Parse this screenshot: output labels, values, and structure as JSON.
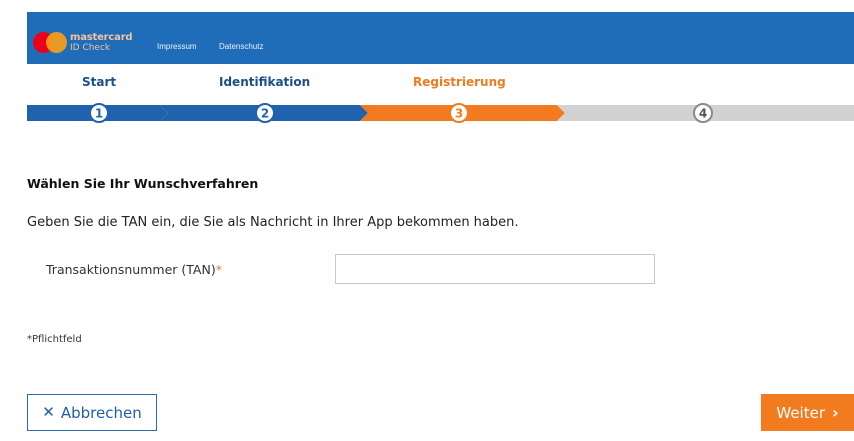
{
  "header": {
    "brand_line1": "mastercard",
    "brand_line2": "ID Check",
    "links": [
      "Impressum",
      "Datenschutz"
    ]
  },
  "stepper": {
    "steps": [
      {
        "number": "1",
        "label": "Start",
        "state": "done"
      },
      {
        "number": "2",
        "label": "Identifikation",
        "state": "done"
      },
      {
        "number": "3",
        "label": "Registrierung",
        "state": "active"
      },
      {
        "number": "4",
        "label": "",
        "state": "pending"
      }
    ],
    "colors": {
      "done": "#1f62ad",
      "active": "#f27b1f",
      "pending": "#d2d2d2"
    }
  },
  "form": {
    "heading": "Wählen Sie Ihr Wunschverfahren",
    "instruction": "Geben Sie die TAN ein, die Sie als Nachricht in Ihrer App bekommen haben.",
    "tan_label": "Transaktionsnummer (TAN)",
    "required_marker": "*",
    "tan_value": "",
    "footnote": "*Pflichtfeld"
  },
  "buttons": {
    "cancel_label": "Abbrechen",
    "cancel_icon": "close-icon",
    "next_label": "Weiter",
    "next_icon": "chevron-right-icon"
  },
  "colors": {
    "header_bg": "#1f6db8",
    "accent_orange": "#f27b1f",
    "cancel_border": "#2b6cb0"
  }
}
